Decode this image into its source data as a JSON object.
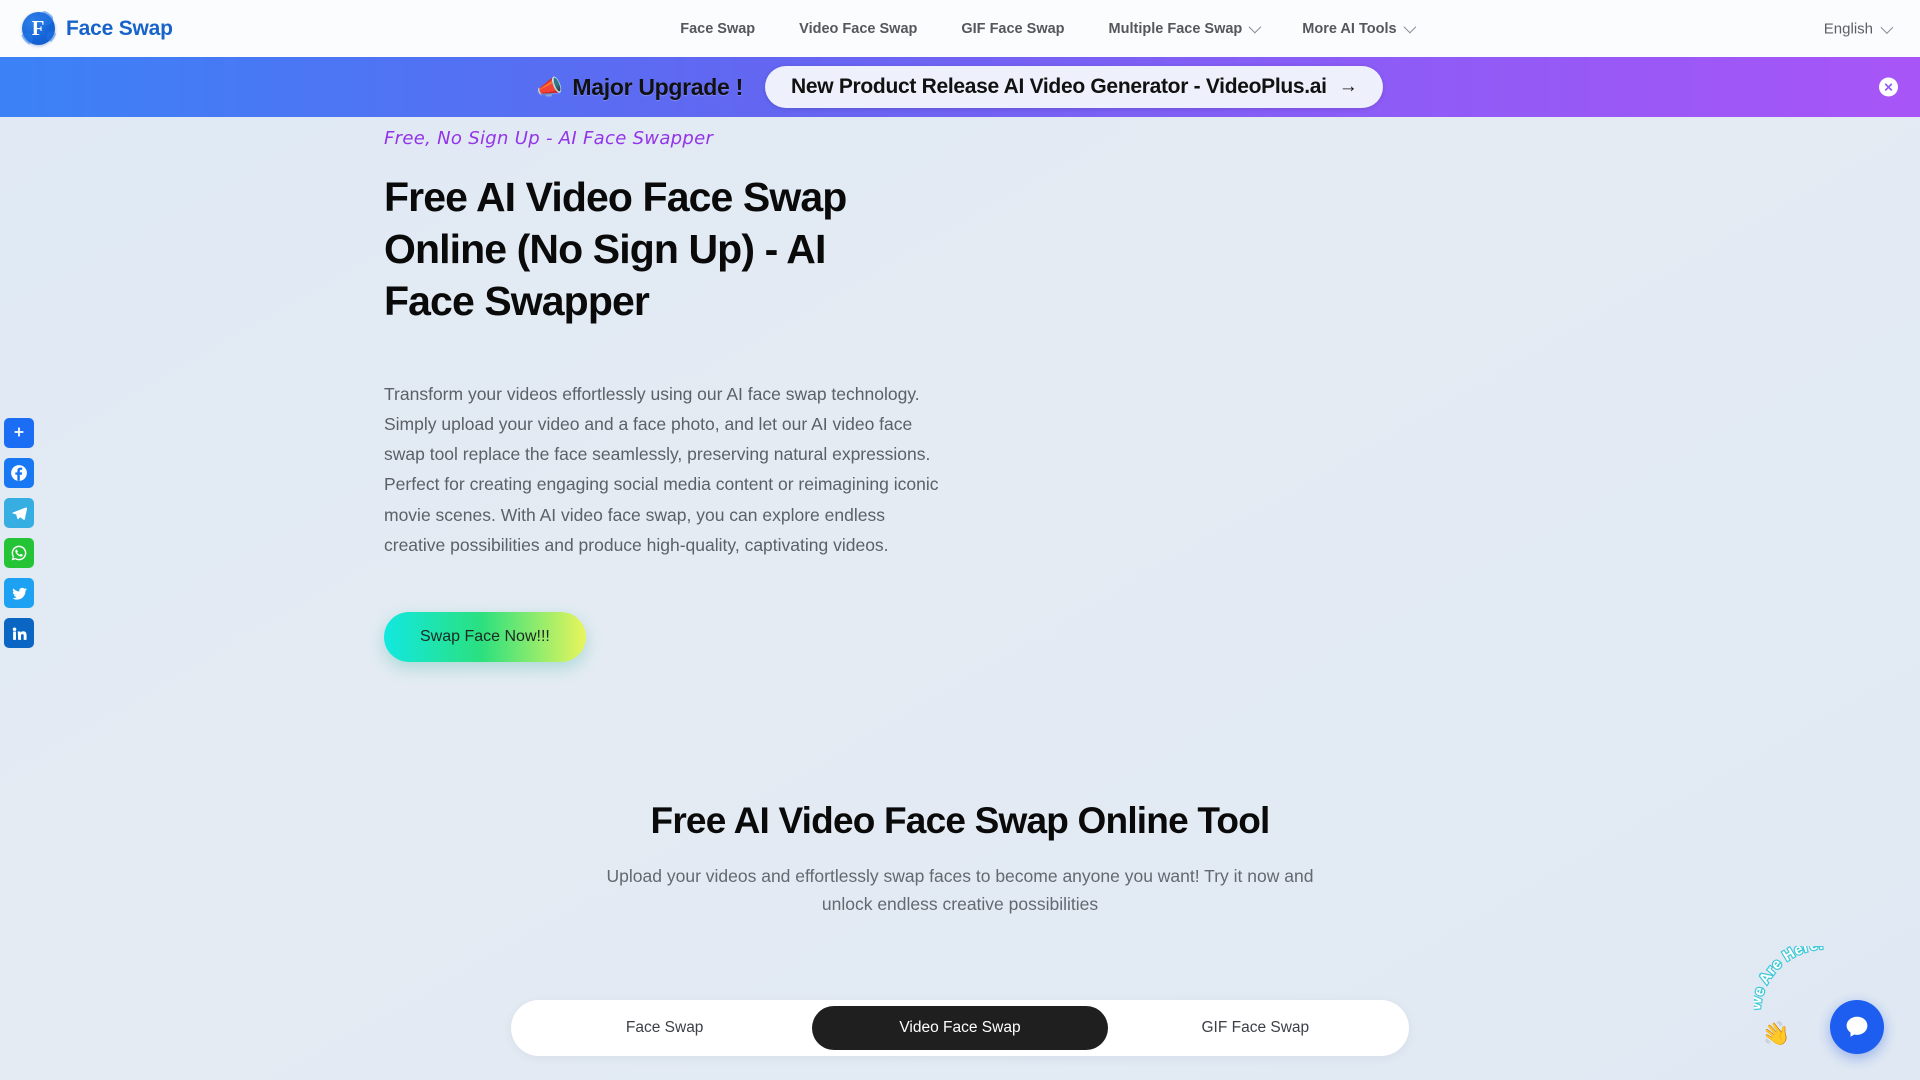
{
  "brand": {
    "name": "Face Swap",
    "logo_letter": "F",
    "logo_color": "#1763c9"
  },
  "nav": {
    "links": [
      {
        "label": "Face Swap",
        "has_dropdown": false
      },
      {
        "label": "Video Face Swap",
        "has_dropdown": false
      },
      {
        "label": "GIF Face Swap",
        "has_dropdown": false
      },
      {
        "label": "Multiple Face Swap",
        "has_dropdown": true
      },
      {
        "label": "More AI Tools",
        "has_dropdown": true
      }
    ],
    "language": "English"
  },
  "promo": {
    "icon": "megaphone",
    "headline": "Major Upgrade !",
    "pill_text": "New Product Release AI Video Generator - VideoPlus.ai",
    "pill_arrow": "→",
    "close_label": "✕",
    "gradient_from": "#3b82f6",
    "gradient_to": "#a855f7"
  },
  "social": [
    {
      "name": "share",
      "label": "Share",
      "color": "#1b6ef3"
    },
    {
      "name": "facebook",
      "label": "Facebook",
      "color": "#1877f2"
    },
    {
      "name": "telegram",
      "label": "Telegram",
      "color": "#37aee2"
    },
    {
      "name": "whatsapp",
      "label": "WhatsApp",
      "color": "#25c436"
    },
    {
      "name": "twitter",
      "label": "Twitter",
      "color": "#1da1f2"
    },
    {
      "name": "linkedin",
      "label": "LinkedIn",
      "color": "#0a66c2"
    }
  ],
  "hero": {
    "eyebrow": "Free, No Sign Up - AI Face Swapper",
    "title": "Free AI Video Face Swap Online (No Sign Up) - AI Face Swapper",
    "paragraph": "Transform your videos effortlessly using our AI face swap technology. Simply upload your video and a face photo, and let our AI video face swap tool replace the face seamlessly, preserving natural expressions. Perfect for creating engaging social media content or reimagining iconic movie scenes. With AI video face swap, you can explore endless creative possibilities and produce high-quality, captivating videos.",
    "cta_label": "Swap Face Now!!!",
    "eyebrow_color": "#9333ea"
  },
  "section": {
    "title": "Free AI Video Face Swap Online Tool",
    "subtitle": "Upload your videos and effortlessly swap faces to become anyone you want! Try it now and unlock endless creative possibilities"
  },
  "tabs": {
    "items": [
      {
        "label": "Face Swap",
        "active": false
      },
      {
        "label": "Video Face Swap",
        "active": true
      },
      {
        "label": "GIF Face Swap",
        "active": false
      }
    ],
    "active_color": "#1f1f1f"
  },
  "chat": {
    "bubble_label": "We Are Here!",
    "wave_emoji": "👋",
    "button_color": "#1d5ef0"
  }
}
